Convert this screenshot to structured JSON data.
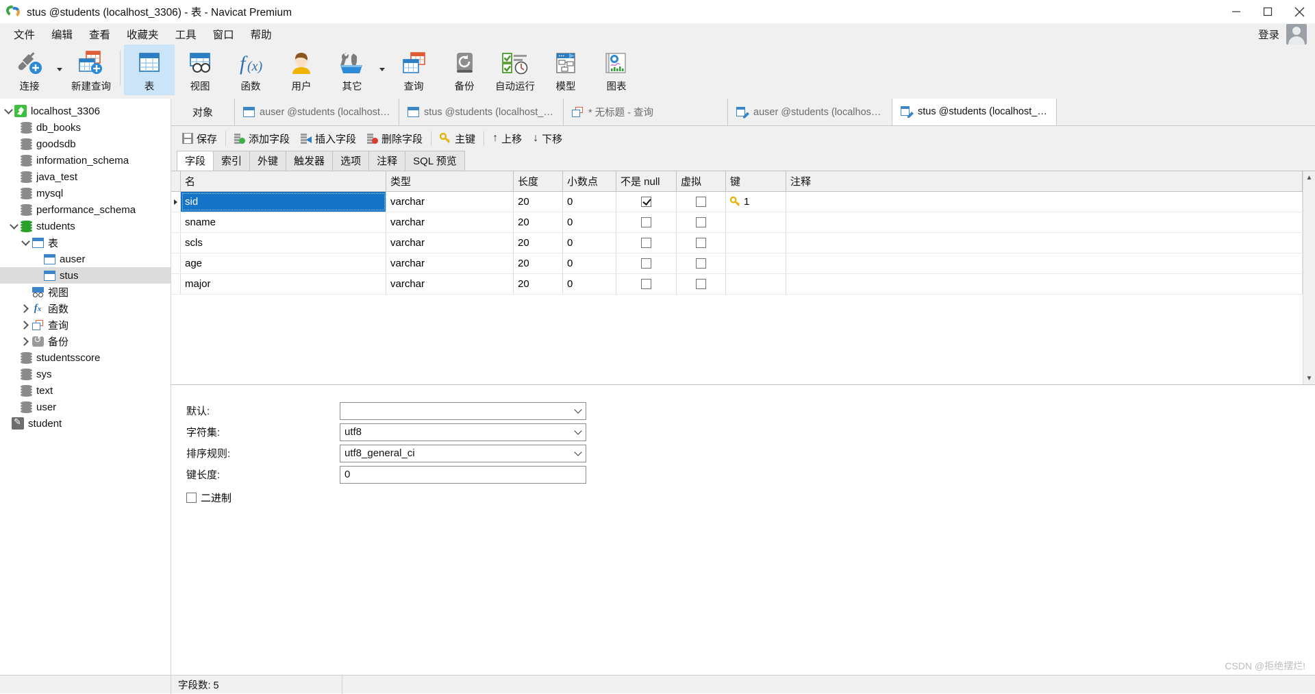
{
  "window": {
    "title": "stus @students (localhost_3306) - 表 - Navicat Premium",
    "app_icon": "navicat-logo-icon",
    "minimize": "minimize-icon",
    "maximize": "maximize-icon",
    "close": "close-icon"
  },
  "menubar": {
    "items": [
      {
        "label": "文件"
      },
      {
        "label": "编辑"
      },
      {
        "label": "查看"
      },
      {
        "label": "收藏夹"
      },
      {
        "label": "工具"
      },
      {
        "label": "窗口"
      },
      {
        "label": "帮助"
      }
    ],
    "login_label": "登录",
    "avatar": "user-avatar-icon"
  },
  "toolbar": {
    "items": [
      {
        "label": "连接",
        "icon": "connection-plug-icon",
        "selected": false,
        "dropdown": true
      },
      {
        "label": "新建查询",
        "icon": "new-query-table-icon",
        "selected": false,
        "dropdown": false
      },
      {
        "label": "表",
        "icon": "table-icon",
        "selected": true,
        "dropdown": false
      },
      {
        "label": "视图",
        "icon": "view-icon",
        "selected": false,
        "dropdown": false
      },
      {
        "label": "函数",
        "icon": "function-fx-icon",
        "selected": false,
        "dropdown": false
      },
      {
        "label": "用户",
        "icon": "user-icon",
        "selected": false,
        "dropdown": false
      },
      {
        "label": "其它",
        "icon": "other-tools-icon",
        "selected": false,
        "dropdown": true
      },
      {
        "label": "查询",
        "icon": "query-icon",
        "selected": false,
        "dropdown": false
      },
      {
        "label": "备份",
        "icon": "backup-icon",
        "selected": false,
        "dropdown": false
      },
      {
        "label": "自动运行",
        "icon": "automation-icon",
        "selected": false,
        "dropdown": false
      },
      {
        "label": "模型",
        "icon": "model-icon",
        "selected": false,
        "dropdown": false
      },
      {
        "label": "图表",
        "icon": "chart-icon",
        "selected": false,
        "dropdown": false
      }
    ]
  },
  "sidebar": {
    "nodes": [
      {
        "label": "localhost_3306",
        "indent": 0,
        "icon": "server-icon",
        "expander": "down",
        "selected": false
      },
      {
        "label": "db_books",
        "indent": 1,
        "icon": "database-icon",
        "expander": "none",
        "selected": false
      },
      {
        "label": "goodsdb",
        "indent": 1,
        "icon": "database-icon",
        "expander": "none",
        "selected": false
      },
      {
        "label": "information_schema",
        "indent": 1,
        "icon": "database-icon",
        "expander": "none",
        "selected": false
      },
      {
        "label": "java_test",
        "indent": 1,
        "icon": "database-icon",
        "expander": "none",
        "selected": false
      },
      {
        "label": "mysql",
        "indent": 1,
        "icon": "database-icon",
        "expander": "none",
        "selected": false
      },
      {
        "label": "performance_schema",
        "indent": 1,
        "icon": "database-icon",
        "expander": "none",
        "selected": false
      },
      {
        "label": "students",
        "indent": 1,
        "icon": "database-open-icon",
        "expander": "down",
        "selected": false
      },
      {
        "label": "表",
        "indent": 2,
        "icon": "table-folder-icon",
        "expander": "down",
        "selected": false
      },
      {
        "label": "auser",
        "indent": 3,
        "icon": "table-icon",
        "expander": "none",
        "selected": false
      },
      {
        "label": "stus",
        "indent": 3,
        "icon": "table-icon",
        "expander": "none",
        "selected": true
      },
      {
        "label": "视图",
        "indent": 2,
        "icon": "view-folder-icon",
        "expander": "none",
        "selected": false
      },
      {
        "label": "函数",
        "indent": 2,
        "icon": "function-folder-icon",
        "expander": "right",
        "selected": false
      },
      {
        "label": "查询",
        "indent": 2,
        "icon": "query-folder-icon",
        "expander": "right",
        "selected": false
      },
      {
        "label": "备份",
        "indent": 2,
        "icon": "backup-folder-icon",
        "expander": "right",
        "selected": false
      },
      {
        "label": "studentsscore",
        "indent": 1,
        "icon": "database-icon",
        "expander": "none",
        "selected": false
      },
      {
        "label": "sys",
        "indent": 1,
        "icon": "database-icon",
        "expander": "none",
        "selected": false
      },
      {
        "label": "text",
        "indent": 1,
        "icon": "database-icon",
        "expander": "none",
        "selected": false
      },
      {
        "label": "user",
        "indent": 1,
        "icon": "database-icon",
        "expander": "none",
        "selected": false
      },
      {
        "label": "student",
        "indent": 0,
        "icon": "sqlite-icon",
        "expander": "none",
        "selected": false
      }
    ]
  },
  "tabstrip": {
    "object_label": "对象",
    "tabs": [
      {
        "label": "auser @students (localhost_...",
        "icon": "table-tab-icon",
        "active": false
      },
      {
        "label": "stus @students (localhost_3...",
        "icon": "table-tab-icon",
        "active": false
      },
      {
        "label": "* 无标题 - 查询",
        "icon": "query-tab-icon",
        "active": false
      },
      {
        "label": "auser @students (localhost _...",
        "icon": "design-table-tab-icon",
        "active": false
      },
      {
        "label": "stus @students (localhost_3...",
        "icon": "design-table-tab-icon",
        "active": true
      }
    ]
  },
  "subtoolbar": {
    "buttons": [
      {
        "label": "保存",
        "icon": "save-icon"
      },
      {
        "label": "添加字段",
        "icon": "add-field-icon"
      },
      {
        "label": "插入字段",
        "icon": "insert-field-icon"
      },
      {
        "label": "删除字段",
        "icon": "delete-field-icon"
      },
      {
        "label": "主键",
        "icon": "primary-key-icon"
      },
      {
        "label": "上移",
        "icon": "move-up-icon"
      },
      {
        "label": "下移",
        "icon": "move-down-icon"
      }
    ]
  },
  "field_tabs": [
    {
      "label": "字段",
      "active": true
    },
    {
      "label": "索引",
      "active": false
    },
    {
      "label": "外键",
      "active": false
    },
    {
      "label": "触发器",
      "active": false
    },
    {
      "label": "选项",
      "active": false
    },
    {
      "label": "注释",
      "active": false
    },
    {
      "label": "SQL 预览",
      "active": false
    }
  ],
  "grid": {
    "headers": [
      "名",
      "类型",
      "长度",
      "小数点",
      "不是 null",
      "虚拟",
      "键",
      "注释"
    ],
    "rows": [
      {
        "name": "sid",
        "type": "varchar",
        "length": "20",
        "decimals": "0",
        "not_null": true,
        "virtual": false,
        "key": "1",
        "comment": "",
        "selected": true
      },
      {
        "name": "sname",
        "type": "varchar",
        "length": "20",
        "decimals": "0",
        "not_null": false,
        "virtual": false,
        "key": "",
        "comment": "",
        "selected": false
      },
      {
        "name": "scls",
        "type": "varchar",
        "length": "20",
        "decimals": "0",
        "not_null": false,
        "virtual": false,
        "key": "",
        "comment": "",
        "selected": false
      },
      {
        "name": "age",
        "type": "varchar",
        "length": "20",
        "decimals": "0",
        "not_null": false,
        "virtual": false,
        "key": "",
        "comment": "",
        "selected": false
      },
      {
        "name": "major",
        "type": "varchar",
        "length": "20",
        "decimals": "0",
        "not_null": false,
        "virtual": false,
        "key": "",
        "comment": "",
        "selected": false
      }
    ]
  },
  "properties": {
    "default": {
      "label": "默认:",
      "value": "",
      "type": "combo"
    },
    "charset": {
      "label": "字符集:",
      "value": "utf8",
      "type": "combo"
    },
    "collation": {
      "label": "排序规则:",
      "value": "utf8_general_ci",
      "type": "combo"
    },
    "key_length": {
      "label": "键长度:",
      "value": "0",
      "type": "text"
    },
    "binary": {
      "label": "二进制",
      "checked": false
    }
  },
  "statusbar": {
    "field_count": "字段数: 5",
    "watermark": "CSDN @拒绝摆烂!"
  },
  "colors": {
    "accent_blue": "#1674c8",
    "toolbar_selected": "#cce4f7",
    "sidebar_selected": "#dcdcdc",
    "table_blue": "#2c7fc3",
    "table_orange": "#e05a33",
    "key_yellow": "#e8b10a",
    "db_green": "#2aa02a"
  }
}
